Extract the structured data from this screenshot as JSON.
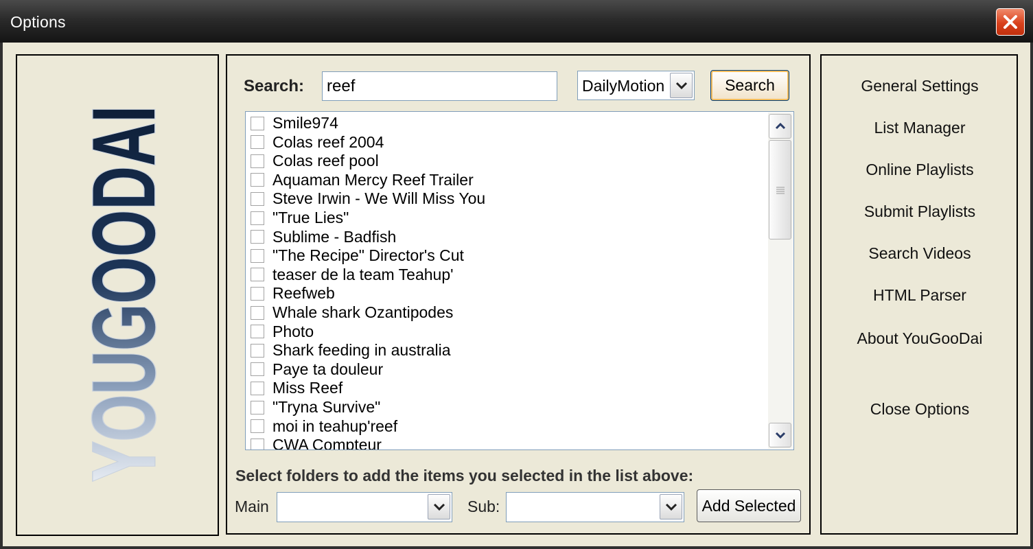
{
  "window": {
    "title": "Options",
    "close_icon": "close-icon"
  },
  "logo": {
    "text": "YOUGOODAI"
  },
  "search": {
    "label": "Search:",
    "value": "reef",
    "provider": "DailyMotion",
    "button_label": "Search"
  },
  "results": {
    "items": [
      "Smile974",
      "Colas reef 2004",
      "Colas reef pool",
      "Aquaman Mercy Reef Trailer",
      "Steve Irwin - We Will Miss You",
      "\"True Lies\"",
      "Sublime - Badfish",
      "\"The Recipe\" Director's Cut",
      "teaser de la team Teahup'",
      "Reefweb",
      "Whale shark Ozantipodes",
      "Photo",
      "Shark feeding in australia",
      "Paye ta douleur",
      "Miss Reef",
      "\"Tryna Survive\"",
      "moi in teahup'reef",
      "CWA Compteur"
    ]
  },
  "folders": {
    "instruction": "Select folders to add the items you selected in the list above:",
    "main_label": "Main",
    "main_value": "",
    "sub_label": "Sub:",
    "sub_value": "",
    "add_button": "Add Selected"
  },
  "nav": {
    "items": [
      "General Settings",
      "List Manager",
      "Online Playlists",
      "Submit Playlists",
      "Search Videos",
      "HTML Parser",
      "About YouGooDai"
    ],
    "close_label": "Close Options"
  },
  "colors": {
    "titlebar": "#2b2b2b",
    "close_button": "#d9411c",
    "background": "#ece9d8",
    "logo_fill": "#1f3a5f"
  }
}
